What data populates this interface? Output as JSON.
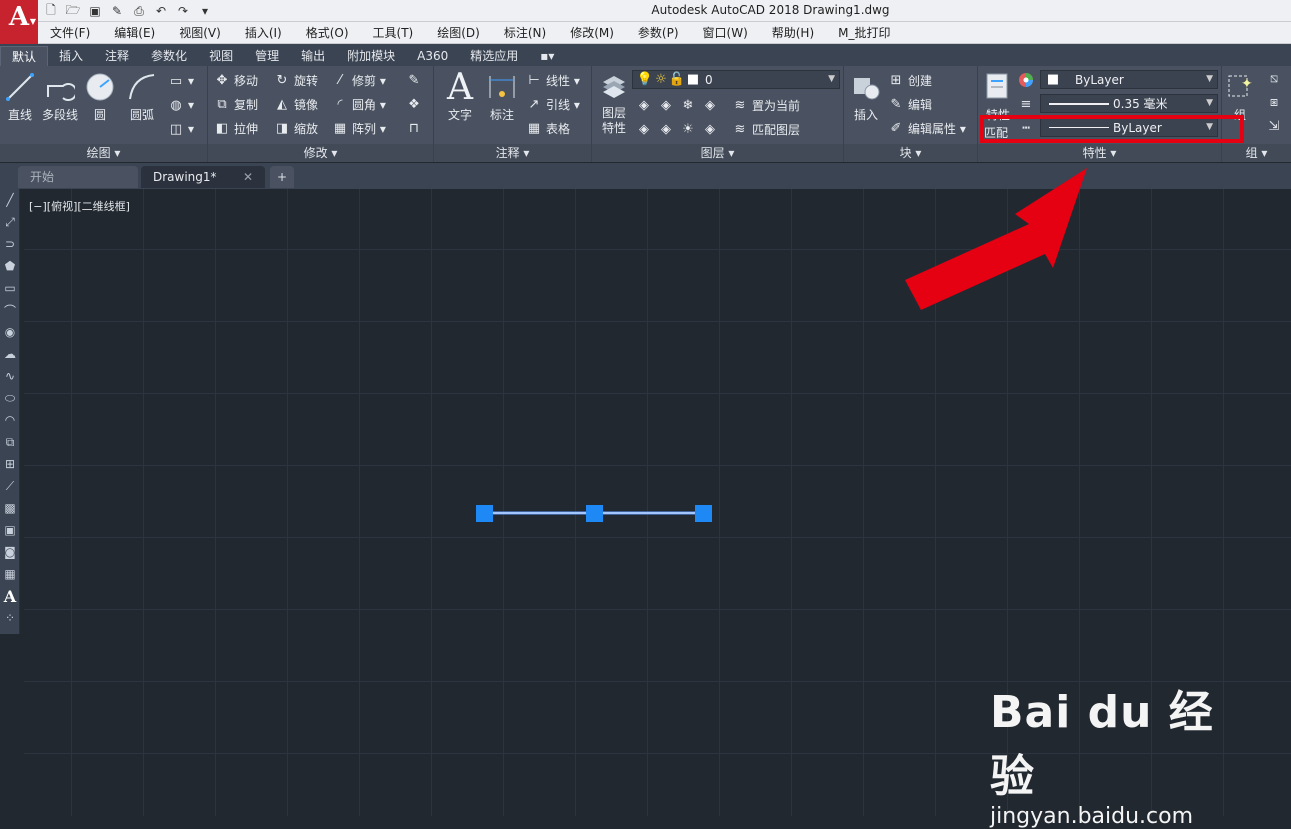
{
  "app": {
    "logo_letter": "A",
    "title": "Autodesk AutoCAD 2018    Drawing1.dwg"
  },
  "qat": [
    "new-icon",
    "open-icon",
    "save-icon",
    "saveas-icon",
    "plot-icon",
    "undo-icon",
    "redo-icon",
    "customize-icon"
  ],
  "menubar": [
    "文件(F)",
    "编辑(E)",
    "视图(V)",
    "插入(I)",
    "格式(O)",
    "工具(T)",
    "绘图(D)",
    "标注(N)",
    "修改(M)",
    "参数(P)",
    "窗口(W)",
    "帮助(H)",
    "M_批打印"
  ],
  "ribbon_tabs": [
    "默认",
    "插入",
    "注释",
    "参数化",
    "视图",
    "管理",
    "输出",
    "附加模块",
    "A360",
    "精选应用",
    "▪▾"
  ],
  "active_tab": "默认",
  "panels": {
    "draw": {
      "title": "绘图 ▾",
      "tools": [
        "直线",
        "多段线",
        "圆",
        "圆弧"
      ]
    },
    "modify": {
      "title": "修改 ▾",
      "tools": [
        "移动",
        "旋转",
        "修剪 ▾",
        "复制",
        "镜像",
        "圆角 ▾",
        "拉伸",
        "缩放",
        "阵列 ▾"
      ]
    },
    "annotation": {
      "title": "注释 ▾",
      "big": [
        "文字",
        "标注"
      ],
      "tools": [
        "线性 ▾",
        "引线 ▾",
        "表格"
      ]
    },
    "layers": {
      "title": "图层 ▾",
      "big": "图层\n特性",
      "layer_value": "0",
      "tools": [
        "置为当前",
        "匹配图层"
      ]
    },
    "block": {
      "title": "块 ▾",
      "big": "插入",
      "tools": [
        "创建",
        "编辑",
        "编辑属性 ▾"
      ]
    },
    "properties": {
      "title": "特性 ▾",
      "big_label": "特性",
      "match_label": "匹配",
      "color_value": "ByLayer",
      "lineweight_value": "0.35 毫米",
      "linetype_value": "ByLayer"
    },
    "group": {
      "title": "组 ▾",
      "big": "组"
    }
  },
  "file_tabs": [
    {
      "label": "开始"
    },
    {
      "label": "Drawing1*"
    }
  ],
  "viewport_label": "[−][俯视][二维线框]",
  "left_toolbar_icons": [
    "line-icon",
    "xline-icon",
    "polyline-icon",
    "polygon-icon",
    "rectangle-icon",
    "arc-icon",
    "circle-icon",
    "revcloud-icon",
    "spline-icon",
    "ellipse-icon",
    "ellipse-arc-icon",
    "insert-block-icon",
    "make-block-icon",
    "point-icon",
    "hatch-icon",
    "gradient-icon",
    "region-icon",
    "table-icon",
    "mtext-icon",
    "add-selected-icon"
  ],
  "watermark": {
    "logo": "Bai du 经验",
    "url": "jingyan.baidu.com"
  },
  "colors": {
    "accent_red": "#e50012",
    "grip_blue": "#1e88f5"
  }
}
